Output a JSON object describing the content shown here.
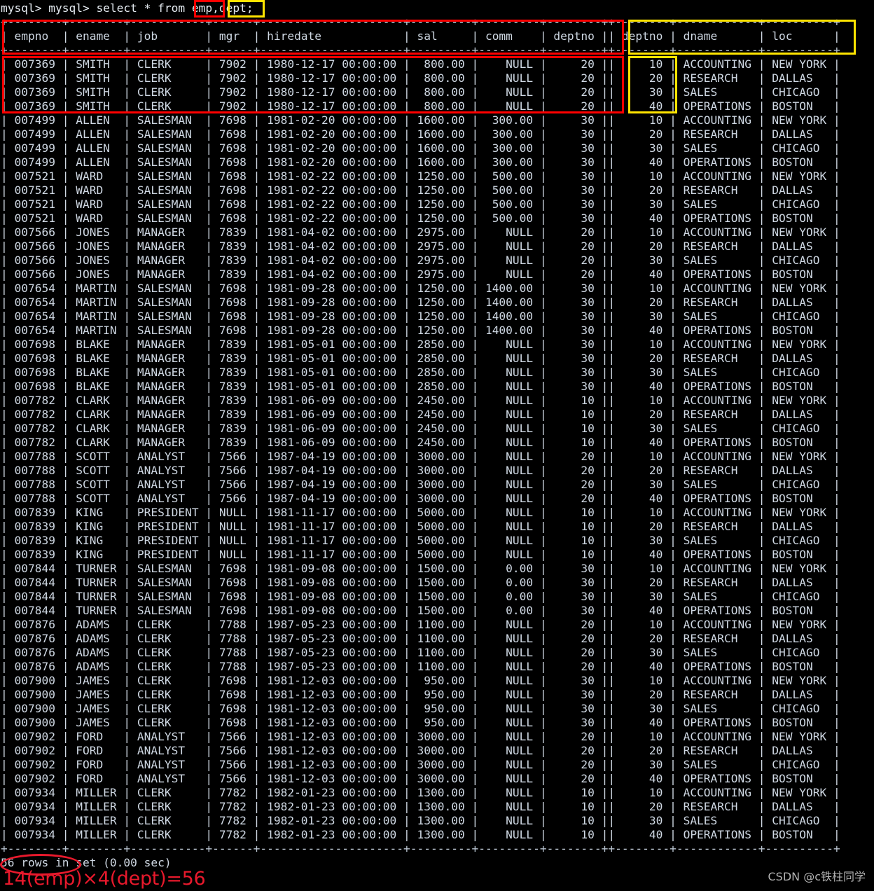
{
  "terminal": {
    "prompt_line": "mysql> mysql> select * from emp,dept;",
    "prompt_prefix": "mysql> mysql> select * from ",
    "table_emp_name": "emp",
    "comma": ",",
    "table_dept_name": "dept",
    "semicolon": ";",
    "result_footer": "56 rows in set (0.00 sec)",
    "separator": "+--------+--------+-----------+------+---------------------+---------+---------+--------++--------+------------+----------+",
    "header_row": "| empno  | ename  | job       | mgr  | hiredate            | sal     | comm    | deptno || deptno | dname      | loc      |",
    "columns_emp": [
      "empno",
      "ename",
      "job",
      "mgr",
      "hiredate",
      "sal",
      "comm",
      "deptno"
    ],
    "columns_dept": [
      "deptno",
      "dname",
      "loc"
    ],
    "emp_rows": [
      {
        "empno": "007369",
        "ename": "SMITH",
        "job": "CLERK",
        "mgr": "7902",
        "hiredate": "1980-12-17 00:00:00",
        "sal": "800.00",
        "comm": "NULL",
        "deptno": "20"
      },
      {
        "empno": "007499",
        "ename": "ALLEN",
        "job": "SALESMAN",
        "mgr": "7698",
        "hiredate": "1981-02-20 00:00:00",
        "sal": "1600.00",
        "comm": "300.00",
        "deptno": "30"
      },
      {
        "empno": "007521",
        "ename": "WARD",
        "job": "SALESMAN",
        "mgr": "7698",
        "hiredate": "1981-02-22 00:00:00",
        "sal": "1250.00",
        "comm": "500.00",
        "deptno": "30"
      },
      {
        "empno": "007566",
        "ename": "JONES",
        "job": "MANAGER",
        "mgr": "7839",
        "hiredate": "1981-04-02 00:00:00",
        "sal": "2975.00",
        "comm": "NULL",
        "deptno": "20"
      },
      {
        "empno": "007654",
        "ename": "MARTIN",
        "job": "SALESMAN",
        "mgr": "7698",
        "hiredate": "1981-09-28 00:00:00",
        "sal": "1250.00",
        "comm": "1400.00",
        "deptno": "30"
      },
      {
        "empno": "007698",
        "ename": "BLAKE",
        "job": "MANAGER",
        "mgr": "7839",
        "hiredate": "1981-05-01 00:00:00",
        "sal": "2850.00",
        "comm": "NULL",
        "deptno": "30"
      },
      {
        "empno": "007782",
        "ename": "CLARK",
        "job": "MANAGER",
        "mgr": "7839",
        "hiredate": "1981-06-09 00:00:00",
        "sal": "2450.00",
        "comm": "NULL",
        "deptno": "10"
      },
      {
        "empno": "007788",
        "ename": "SCOTT",
        "job": "ANALYST",
        "mgr": "7566",
        "hiredate": "1987-04-19 00:00:00",
        "sal": "3000.00",
        "comm": "NULL",
        "deptno": "20"
      },
      {
        "empno": "007839",
        "ename": "KING",
        "job": "PRESIDENT",
        "mgr": "NULL",
        "hiredate": "1981-11-17 00:00:00",
        "sal": "5000.00",
        "comm": "NULL",
        "deptno": "10"
      },
      {
        "empno": "007844",
        "ename": "TURNER",
        "job": "SALESMAN",
        "mgr": "7698",
        "hiredate": "1981-09-08 00:00:00",
        "sal": "1500.00",
        "comm": "0.00",
        "deptno": "30"
      },
      {
        "empno": "007876",
        "ename": "ADAMS",
        "job": "CLERK",
        "mgr": "7788",
        "hiredate": "1987-05-23 00:00:00",
        "sal": "1100.00",
        "comm": "NULL",
        "deptno": "20"
      },
      {
        "empno": "007900",
        "ename": "JAMES",
        "job": "CLERK",
        "mgr": "7698",
        "hiredate": "1981-12-03 00:00:00",
        "sal": "950.00",
        "comm": "NULL",
        "deptno": "30"
      },
      {
        "empno": "007902",
        "ename": "FORD",
        "job": "ANALYST",
        "mgr": "7566",
        "hiredate": "1981-12-03 00:00:00",
        "sal": "3000.00",
        "comm": "NULL",
        "deptno": "20"
      },
      {
        "empno": "007934",
        "ename": "MILLER",
        "job": "CLERK",
        "mgr": "7782",
        "hiredate": "1982-01-23 00:00:00",
        "sal": "1300.00",
        "comm": "NULL",
        "deptno": "10"
      }
    ],
    "dept_rows": [
      {
        "deptno": "10",
        "dname": "ACCOUNTING",
        "loc": "NEW YORK"
      },
      {
        "deptno": "20",
        "dname": "RESEARCH",
        "loc": "DALLAS"
      },
      {
        "deptno": "30",
        "dname": "SALES",
        "loc": "CHICAGO"
      },
      {
        "deptno": "40",
        "dname": "OPERATIONS",
        "loc": "BOSTON"
      }
    ]
  },
  "annotations": {
    "calc_note": "14(emp)×4(dept)=56",
    "watermark": "CSDN @c铁柱同学",
    "row_count_circled": "56 rows",
    "colors": {
      "red": "#ff0000",
      "yellow": "#ffe400",
      "ellipse_red": "#e8192c",
      "note_red": "#e8192c",
      "terminal_bg": "#000000",
      "terminal_fg": "#cfd8e3",
      "watermark_fg": "#b3b3b3"
    }
  }
}
